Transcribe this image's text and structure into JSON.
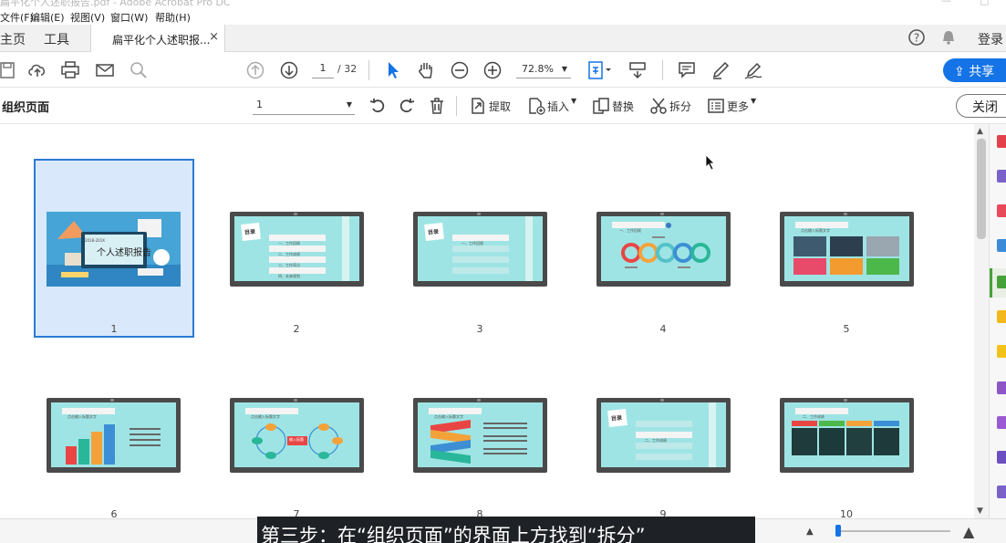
{
  "window": {
    "title": "扁平化个人述职报告.pdf - Adobe Acrobat Pro DC"
  },
  "menu": {
    "items": [
      "文件(F)",
      "编辑(E)",
      "视图(V)",
      "窗口(W)",
      "帮助(H)"
    ]
  },
  "tabs": {
    "home": "主页",
    "tools": "工具",
    "document": "扁平化个人述职报...",
    "close": "×"
  },
  "account": {
    "login": "登录"
  },
  "toolbar": {
    "current_page": "1",
    "total_pages": "/ 32",
    "zoom": "72.8%",
    "share_label": "共享"
  },
  "organize": {
    "title": "组织页面",
    "page_select": "1",
    "extract": "提取",
    "insert": "插入",
    "replace": "替换",
    "split": "拆分",
    "more": "更多",
    "close": "关闭"
  },
  "pages": [
    {
      "number": "1",
      "selected": true
    },
    {
      "number": "2"
    },
    {
      "number": "3"
    },
    {
      "number": "4"
    },
    {
      "number": "5"
    },
    {
      "number": "6"
    },
    {
      "number": "7"
    },
    {
      "number": "8"
    },
    {
      "number": "9"
    },
    {
      "number": "10"
    }
  ],
  "thumbnails": {
    "cover_year": "2018-201X",
    "cover_title": "个人述职报告",
    "toc_label": "目录",
    "toc_items": [
      "一、工作回顾",
      "二、工作成绩",
      "三、工作亮点",
      "四、未来规划"
    ],
    "header_text": "点击输入标题文字",
    "sec1_header": "一、工作回顾",
    "sec2_header": "二、工作成绩",
    "center_text": "输入标题"
  },
  "caption": "第三步：在“组织页面”的界面上方找到“拆分”",
  "colors": {
    "accent": "#1473e6",
    "selection": "#d9e8fa",
    "slide_bg": "#9fe4e4"
  }
}
